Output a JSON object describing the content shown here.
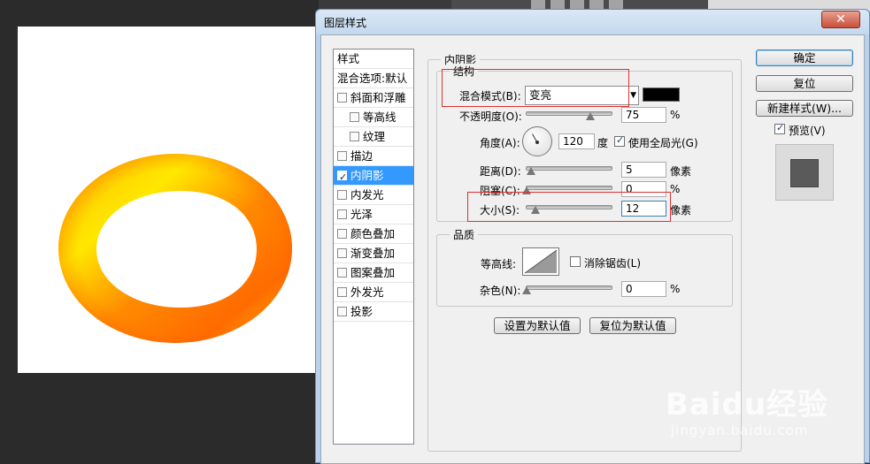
{
  "dialog": {
    "title": "图层样式"
  },
  "style_list": {
    "header": "样式",
    "blend_options": "混合选项:默认",
    "items": [
      {
        "label": "斜面和浮雕",
        "checked": false,
        "indent": false
      },
      {
        "label": "等高线",
        "checked": false,
        "indent": true
      },
      {
        "label": "纹理",
        "checked": false,
        "indent": true
      },
      {
        "label": "描边",
        "checked": false,
        "indent": false
      },
      {
        "label": "内阴影",
        "checked": true,
        "indent": false,
        "selected": true
      },
      {
        "label": "内发光",
        "checked": false,
        "indent": false
      },
      {
        "label": "光泽",
        "checked": false,
        "indent": false
      },
      {
        "label": "颜色叠加",
        "checked": false,
        "indent": false
      },
      {
        "label": "渐变叠加",
        "checked": false,
        "indent": false
      },
      {
        "label": "图案叠加",
        "checked": false,
        "indent": false
      },
      {
        "label": "外发光",
        "checked": false,
        "indent": false
      },
      {
        "label": "投影",
        "checked": false,
        "indent": false
      }
    ]
  },
  "panel": {
    "title": "内阴影",
    "structure": {
      "legend": "结构",
      "blend_mode_label": "混合模式(B):",
      "blend_mode_value": "变亮",
      "shadow_color": "#000000",
      "opacity_label": "不透明度(O):",
      "opacity_value": "75",
      "opacity_unit": "%",
      "angle_label": "角度(A):",
      "angle_value": "120",
      "angle_unit": "度",
      "global_light_label": "使用全局光(G)",
      "global_light_checked": true,
      "distance_label": "距离(D):",
      "distance_value": "5",
      "distance_unit": "像素",
      "choke_label": "阻塞(C):",
      "choke_value": "0",
      "choke_unit": "%",
      "size_label": "大小(S):",
      "size_value": "12",
      "size_unit": "像素"
    },
    "quality": {
      "legend": "品质",
      "contour_label": "等高线:",
      "anti_alias_label": "消除锯齿(L)",
      "anti_alias_checked": false,
      "noise_label": "杂色(N):",
      "noise_value": "0",
      "noise_unit": "%"
    },
    "set_default_label": "设置为默认值",
    "reset_default_label": "复位为默认值"
  },
  "buttons": {
    "ok": "确定",
    "reset": "复位",
    "new_style": "新建样式(W)...",
    "preview_label": "预览(V)",
    "preview_checked": true
  },
  "watermark": {
    "brand": "Baidu经验",
    "url": "jingyan.baidu.com"
  }
}
